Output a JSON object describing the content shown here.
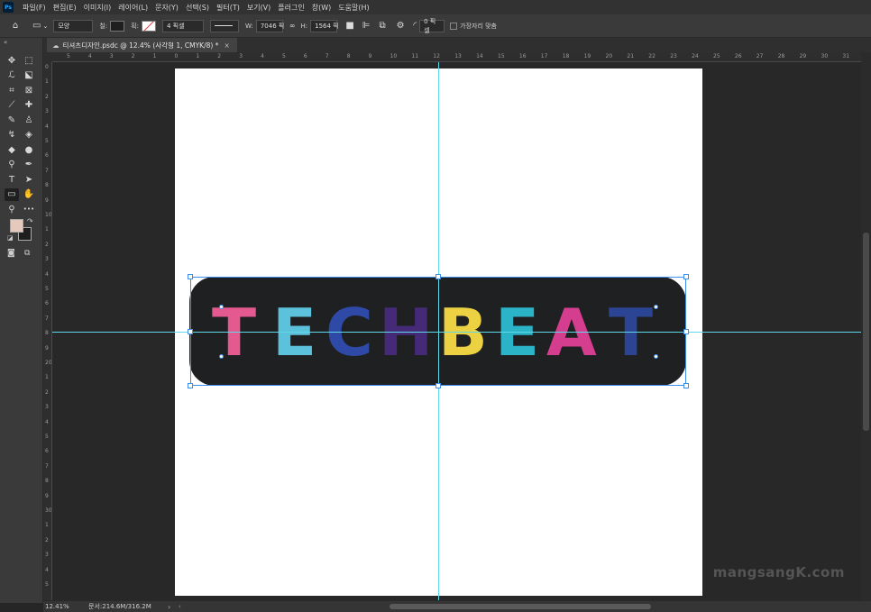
{
  "menubar": {
    "logo": "Ps",
    "items": [
      "파일(F)",
      "편집(E)",
      "이미지(I)",
      "레이어(L)",
      "문자(Y)",
      "선택(S)",
      "필터(T)",
      "보기(V)",
      "플러그인",
      "창(W)",
      "도움말(H)"
    ]
  },
  "options": {
    "mode": "모양",
    "fill_label": "칠:",
    "stroke_label": "획:",
    "stroke_size": "4 픽셀",
    "w_label": "W:",
    "w_value": "7046 픽",
    "h_label": "H:",
    "h_value": "1564 픽",
    "radius": "0 픽셀",
    "align_edges": "가장자리 맞춤"
  },
  "tab": {
    "title": "티셔츠디자인.psdc @ 12.4% (사각형 1, CMYK/8) *",
    "close": "×"
  },
  "toolbar": {
    "collapse": "«",
    "tools": [
      {
        "name": "move-tool-icon",
        "glyph": "✥"
      },
      {
        "name": "marquee-tool-icon",
        "glyph": "⬚"
      },
      {
        "name": "lasso-tool-icon",
        "glyph": "ℒ"
      },
      {
        "name": "object-select-tool-icon",
        "glyph": "⬕"
      },
      {
        "name": "crop-tool-icon",
        "glyph": "⌗"
      },
      {
        "name": "frame-tool-icon",
        "glyph": "⊠"
      },
      {
        "name": "eyedropper-tool-icon",
        "glyph": "⟋"
      },
      {
        "name": "healing-brush-tool-icon",
        "glyph": "✚"
      },
      {
        "name": "brush-tool-icon",
        "glyph": "✎"
      },
      {
        "name": "clone-stamp-tool-icon",
        "glyph": "♙"
      },
      {
        "name": "history-brush-tool-icon",
        "glyph": "↯"
      },
      {
        "name": "eraser-tool-icon",
        "glyph": "◈"
      },
      {
        "name": "paint-bucket-tool-icon",
        "glyph": "◆"
      },
      {
        "name": "blur-tool-icon",
        "glyph": "●"
      },
      {
        "name": "dodge-tool-icon",
        "glyph": "⚲"
      },
      {
        "name": "pen-tool-icon",
        "glyph": "✒"
      },
      {
        "name": "type-tool-icon",
        "glyph": "T"
      },
      {
        "name": "path-select-tool-icon",
        "glyph": "➤"
      },
      {
        "name": "rectangle-tool-icon",
        "glyph": "▭"
      },
      {
        "name": "hand-tool-icon",
        "glyph": "✋"
      },
      {
        "name": "zoom-tool-icon",
        "glyph": "⚲"
      },
      {
        "name": "more-tools-icon",
        "glyph": "•••"
      }
    ]
  },
  "colors": {
    "foreground": "#e6c9bd",
    "background": "#1e1e1e",
    "badge": "#1f2021",
    "guide": "#5fd8e8",
    "selection": "#3d8eea"
  },
  "ruler_h_labels": [
    "5",
    "4",
    "3",
    "2",
    "1",
    "0",
    "1",
    "2",
    "3",
    "4",
    "5",
    "6",
    "7",
    "8",
    "9",
    "10",
    "11",
    "12",
    "13",
    "14",
    "15",
    "16",
    "17",
    "18",
    "19",
    "20",
    "21",
    "22",
    "23",
    "24",
    "25",
    "26",
    "27",
    "28",
    "29",
    "30",
    "31",
    "32"
  ],
  "ruler_v_labels": [
    "0",
    "1",
    "2",
    "3",
    "4",
    "5",
    "6",
    "7",
    "8",
    "9",
    "10",
    "1",
    "2",
    "3",
    "4",
    "5",
    "6",
    "7",
    "8",
    "9",
    "20",
    "1",
    "2",
    "3",
    "4",
    "5",
    "6",
    "7",
    "8",
    "9",
    "30",
    "1",
    "2",
    "3",
    "4",
    "5"
  ],
  "artwork": {
    "letters": [
      {
        "char": "T",
        "color": "#e4598f"
      },
      {
        "char": "E",
        "color": "#5cc2dc"
      },
      {
        "char": "C",
        "color": "#2e4aa6"
      },
      {
        "char": "H",
        "color": "#452a78"
      },
      {
        "char": "B",
        "color": "#ecd142"
      },
      {
        "char": "E",
        "color": "#2bb3c8"
      },
      {
        "char": "A",
        "color": "#d53d8e"
      },
      {
        "char": "T",
        "color": "#2c4494"
      }
    ]
  },
  "watermark": "mangsangK.com",
  "status": {
    "zoom": "12.41%",
    "doc": "문서:214.6M/316.2M",
    "arrow": "›",
    "scroll_prev": "‹"
  }
}
